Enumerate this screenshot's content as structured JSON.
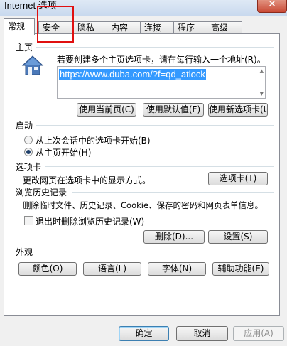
{
  "window": {
    "title": "Internet 选项",
    "close_glyph": "✕"
  },
  "tabs": [
    {
      "label": "常规",
      "active": true
    },
    {
      "label": "安全",
      "active": false
    },
    {
      "label": "隐私",
      "active": false
    },
    {
      "label": "内容",
      "active": false
    },
    {
      "label": "连接",
      "active": false
    },
    {
      "label": "程序",
      "active": false
    },
    {
      "label": "高级",
      "active": false
    }
  ],
  "home": {
    "section_label": "主页",
    "instruction": "若要创建多个主页选项卡，请在每行输入一个地址(R)。",
    "url": "https://www.duba.com/?f=qd_atlock",
    "buttons": {
      "use_current": "使用当前页(C)",
      "use_default": "使用默认值(F)",
      "use_new_tab": "使用新选项卡(U)"
    }
  },
  "startup": {
    "section_label": "启动",
    "option_last_session": "从上次会话中的选项卡开始(B)",
    "option_home": "从主页开始(H)",
    "selected": "home"
  },
  "tabs_section": {
    "section_label": "选项卡",
    "description": "更改网页在选项卡中的显示方式。",
    "button": "选项卡(T)"
  },
  "history": {
    "section_label": "浏览历史记录",
    "description": "删除临时文件、历史记录、Cookie、保存的密码和网页表单信息。",
    "checkbox_label": "退出时删除浏览历史记录(W)",
    "checkbox_checked": false,
    "delete_button": "删除(D)...",
    "settings_button": "设置(S)"
  },
  "appearance": {
    "section_label": "外观",
    "colors_button": "颜色(O)",
    "languages_button": "语言(L)",
    "fonts_button": "字体(N)",
    "accessibility_button": "辅助功能(E)"
  },
  "footer": {
    "ok_button": "确定",
    "cancel_button": "取消",
    "apply_button": "应用(A)"
  }
}
